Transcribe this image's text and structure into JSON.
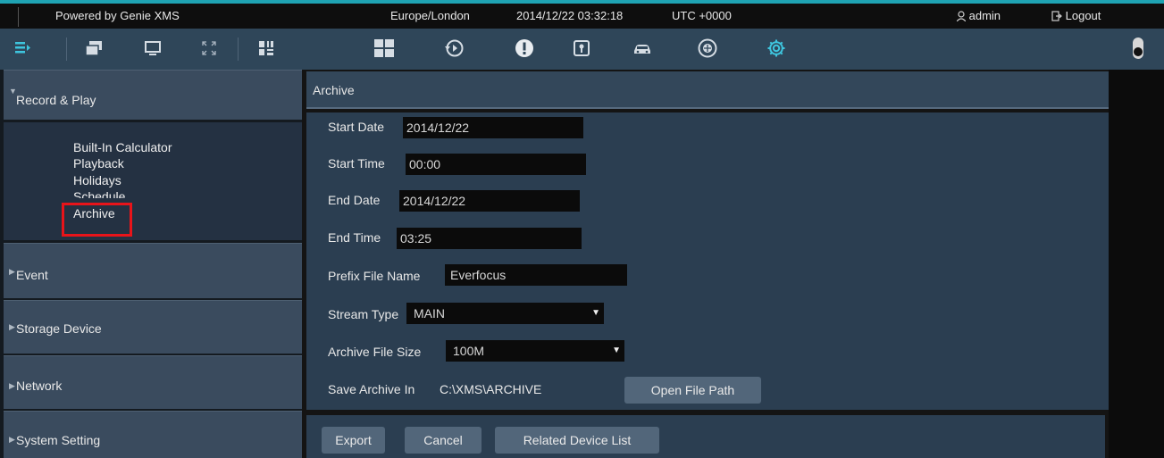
{
  "topbar": {
    "powered_by": "Powered by Genie XMS",
    "timezone": "Europe/London",
    "datetime": "2014/12/22 03:32:18",
    "utc": "UTC +0000",
    "user": "admin",
    "logout": "Logout",
    "accent_color": "#1fa3b3"
  },
  "toolbar": {
    "icons": [
      "menu-icon",
      "window-icon",
      "monitor-icon",
      "fullscreen-icon",
      "layout-grid-icon",
      "grid-view-icon",
      "playback-icon",
      "alert-icon",
      "lock-icon",
      "car-icon",
      "network-icon",
      "settings-icon",
      "toggle-icon"
    ],
    "active_color": "#3ec5de"
  },
  "sidebar": {
    "sections": [
      {
        "label": "Record & Play",
        "expanded": true
      },
      {
        "label": "Event"
      },
      {
        "label": "Storage Device"
      },
      {
        "label": "Network"
      },
      {
        "label": "System Setting"
      }
    ],
    "subitems": [
      "Built-In Calculator",
      "Playback",
      "Holidays",
      "Schedule",
      "Archive"
    ],
    "highlight_color": "#e8141a"
  },
  "archive": {
    "title": "Archive",
    "start_date_label": "Start Date",
    "start_date": "2014/12/22",
    "start_time_label": "Start Time",
    "start_time": "00:00",
    "end_date_label": "End Date",
    "end_date": "2014/12/22",
    "end_time_label": "End Time",
    "end_time": "03:25",
    "prefix_label": "Prefix File Name",
    "prefix": "Everfocus",
    "stream_label": "Stream Type",
    "stream": "MAIN",
    "size_label": "Archive File Size",
    "size": "100M",
    "save_label": "Save Archive In",
    "save_path": "C:\\XMS\\ARCHIVE",
    "open_path_button": "Open File Path"
  },
  "actions": {
    "export": "Export",
    "cancel": "Cancel",
    "related": "Related Device List"
  }
}
